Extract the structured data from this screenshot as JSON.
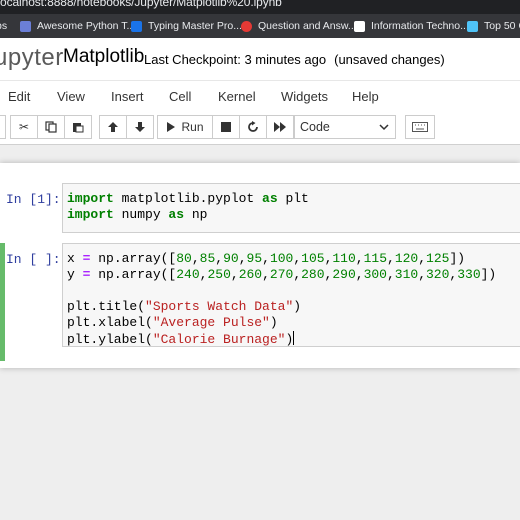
{
  "browser": {
    "url": "ocalhost:8888/notebooks/Jupyter/Matplotlib%20.ipynb",
    "bookmarks": [
      {
        "label": "ps",
        "color": "#4285f4"
      },
      {
        "label": "Awesome Python T...",
        "color": "#6b7fd7"
      },
      {
        "label": "Typing Master Pro...",
        "color": "#1a73e8"
      },
      {
        "label": "Question and Answ...",
        "color": "#e53935"
      },
      {
        "label": "Information Techno...",
        "color": "#ffffff"
      },
      {
        "label": "Top 50 C",
        "color": "#4fc3f7"
      }
    ]
  },
  "header": {
    "logo": "upyter",
    "notebook_name": "Matplotlib",
    "checkpoint": "Last Checkpoint: 3 minutes ago",
    "unsaved": "(unsaved changes)"
  },
  "menu": [
    "Edit",
    "View",
    "Insert",
    "Cell",
    "Kernel",
    "Widgets",
    "Help"
  ],
  "toolbar": {
    "run_label": "Run",
    "cell_type": "Code",
    "icons": [
      "save-icon",
      "cut-icon",
      "copy-icon",
      "paste-icon",
      "move-up-icon",
      "move-down-icon",
      "run-icon",
      "stop-icon",
      "restart-icon",
      "fast-forward-icon",
      "chevron-down-icon",
      "keyboard-icon"
    ]
  },
  "cells": [
    {
      "prompt": "In [1]:",
      "lines": [
        [
          [
            "kw",
            "import"
          ],
          [
            "t",
            " matplotlib.pyplot "
          ],
          [
            "kw",
            "as"
          ],
          [
            "t",
            " plt"
          ]
        ],
        [
          [
            "kw",
            "import"
          ],
          [
            "t",
            " numpy "
          ],
          [
            "kw",
            "as"
          ],
          [
            "t",
            " np"
          ]
        ]
      ]
    },
    {
      "prompt": "In [ ]:",
      "lines": [
        [
          [
            "t",
            "x "
          ],
          [
            "op",
            "="
          ],
          [
            "t",
            " np.array(["
          ],
          [
            "num",
            "80"
          ],
          [
            "t",
            ","
          ],
          [
            "num",
            "85"
          ],
          [
            "t",
            ","
          ],
          [
            "num",
            "90"
          ],
          [
            "t",
            ","
          ],
          [
            "num",
            "95"
          ],
          [
            "t",
            ","
          ],
          [
            "num",
            "100"
          ],
          [
            "t",
            ","
          ],
          [
            "num",
            "105"
          ],
          [
            "t",
            ","
          ],
          [
            "num",
            "110"
          ],
          [
            "t",
            ","
          ],
          [
            "num",
            "115"
          ],
          [
            "t",
            ","
          ],
          [
            "num",
            "120"
          ],
          [
            "t",
            ","
          ],
          [
            "num",
            "125"
          ],
          [
            "t",
            "])"
          ]
        ],
        [
          [
            "t",
            "y "
          ],
          [
            "op",
            "="
          ],
          [
            "t",
            " np.array(["
          ],
          [
            "num",
            "240"
          ],
          [
            "t",
            ","
          ],
          [
            "num",
            "250"
          ],
          [
            "t",
            ","
          ],
          [
            "num",
            "260"
          ],
          [
            "t",
            ","
          ],
          [
            "num",
            "270"
          ],
          [
            "t",
            ","
          ],
          [
            "num",
            "280"
          ],
          [
            "t",
            ","
          ],
          [
            "num",
            "290"
          ],
          [
            "t",
            ","
          ],
          [
            "num",
            "300"
          ],
          [
            "t",
            ","
          ],
          [
            "num",
            "310"
          ],
          [
            "t",
            ","
          ],
          [
            "num",
            "320"
          ],
          [
            "t",
            ","
          ],
          [
            "num",
            "330"
          ],
          [
            "t",
            "])"
          ]
        ],
        [],
        [
          [
            "t",
            "plt.title("
          ],
          [
            "str",
            "\"Sports Watch Data\""
          ],
          [
            "t",
            ")"
          ]
        ],
        [
          [
            "t",
            "plt.xlabel("
          ],
          [
            "str",
            "\"Average Pulse\""
          ],
          [
            "t",
            ")"
          ]
        ],
        [
          [
            "t",
            "plt.ylabel("
          ],
          [
            "str",
            "\"Calorie Burnage\""
          ],
          [
            "t",
            ")"
          ]
        ]
      ]
    }
  ],
  "colors": {
    "selected_border": "#66bb6a",
    "prompt": "#303f9f"
  }
}
